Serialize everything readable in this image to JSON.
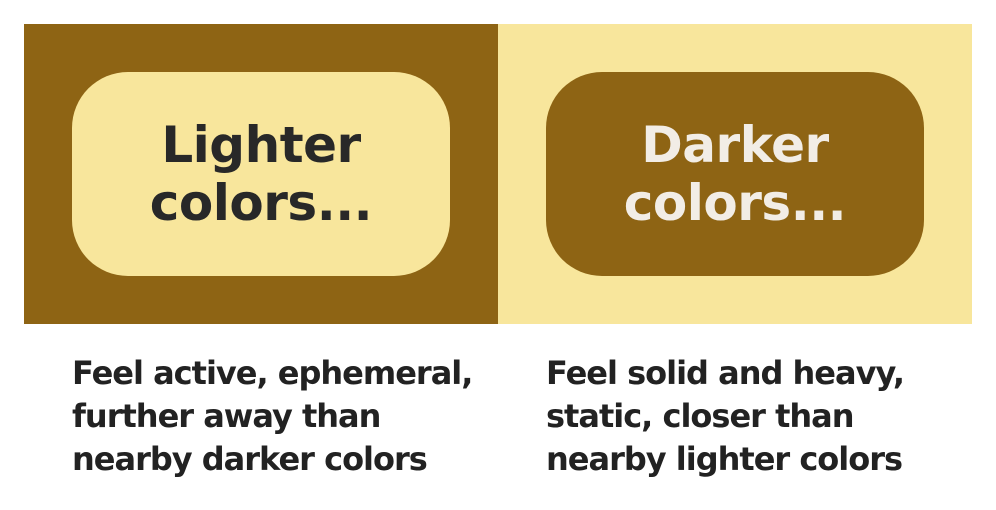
{
  "colors": {
    "dark_gold": "#8e6414",
    "light_yellow": "#f8e69c",
    "dark_text": "#282828",
    "light_text": "#f2ede6",
    "caption_text": "#222222"
  },
  "left": {
    "pill_text": "Lighter\ncolors...",
    "caption": "Feel active, ephemeral,\nfurther away than\nnearby darker colors"
  },
  "right": {
    "pill_text": "Darker\ncolors...",
    "caption": "Feel solid and heavy,\nstatic, closer than\nnearby lighter colors"
  }
}
